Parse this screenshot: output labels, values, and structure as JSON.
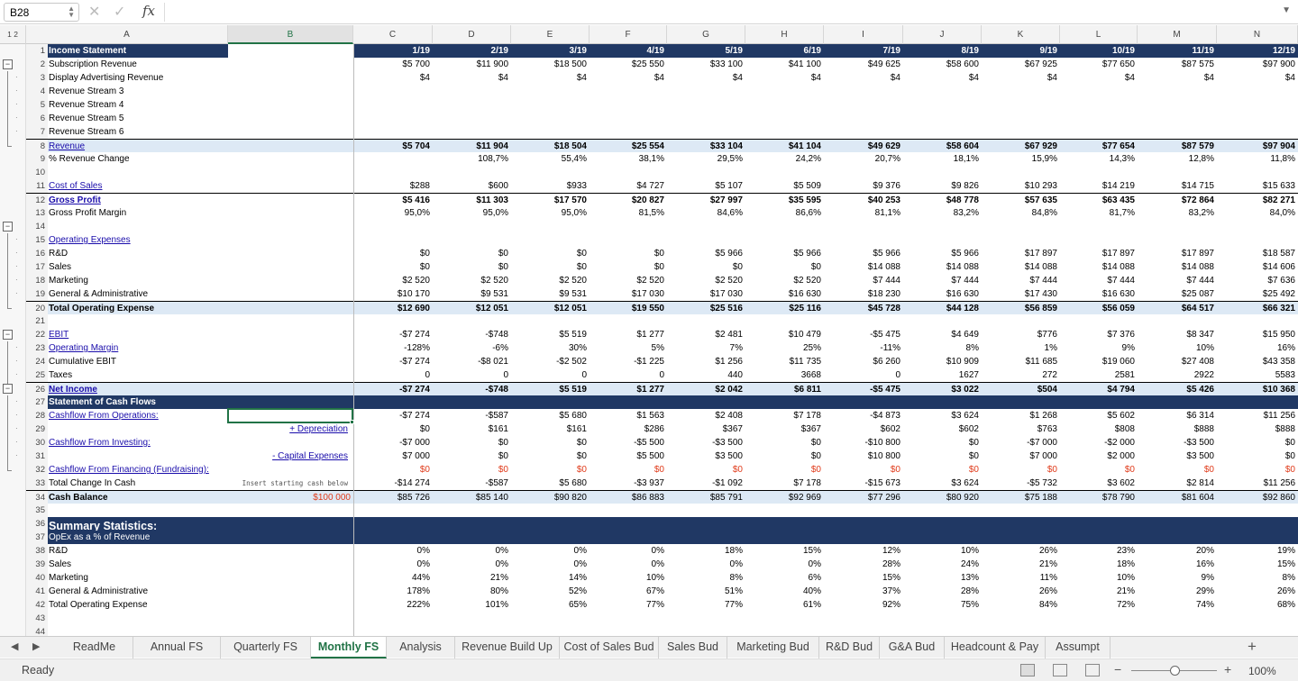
{
  "formula_bar": {
    "cell_ref": "B28",
    "formula": ""
  },
  "columns": [
    "A",
    "B",
    "C",
    "D",
    "E",
    "F",
    "G",
    "H",
    "I",
    "J",
    "K",
    "L",
    "M",
    "N"
  ],
  "outline_levels": [
    "1",
    "2"
  ],
  "rows": [
    {
      "n": "1",
      "label": "Income Statement",
      "style": "dark-label",
      "vals": [
        "1/19",
        "2/19",
        "3/19",
        "4/19",
        "5/19",
        "6/19",
        "7/19",
        "8/19",
        "9/19",
        "10/19",
        "11/19",
        "12/19"
      ]
    },
    {
      "n": "2",
      "label": "Subscription Revenue",
      "vals": [
        "$5 700",
        "$11 900",
        "$18 500",
        "$25 550",
        "$33 100",
        "$41 100",
        "$49 625",
        "$58 600",
        "$67 925",
        "$77 650",
        "$87 575",
        "$97 900"
      ]
    },
    {
      "n": "3",
      "label": "Display Advertising Revenue",
      "vals": [
        "$4",
        "$4",
        "$4",
        "$4",
        "$4",
        "$4",
        "$4",
        "$4",
        "$4",
        "$4",
        "$4",
        "$4"
      ]
    },
    {
      "n": "4",
      "label": "Revenue Stream 3",
      "vals": []
    },
    {
      "n": "5",
      "label": "Revenue Stream 4",
      "vals": []
    },
    {
      "n": "6",
      "label": "Revenue Stream 5",
      "vals": []
    },
    {
      "n": "7",
      "label": "Revenue Stream 6",
      "vals": []
    },
    {
      "n": "8",
      "label": "Revenue",
      "style": "hl link",
      "bold_vals": true,
      "vals": [
        "$5 704",
        "$11 904",
        "$18 504",
        "$25 554",
        "$33 104",
        "$41 104",
        "$49 629",
        "$58 604",
        "$67 929",
        "$77 654",
        "$87 579",
        "$97 904"
      ]
    },
    {
      "n": "9",
      "label": "% Revenue Change",
      "vals": [
        "",
        "108,7%",
        "55,4%",
        "38,1%",
        "29,5%",
        "24,2%",
        "20,7%",
        "18,1%",
        "15,9%",
        "14,3%",
        "12,8%",
        "11,8%"
      ]
    },
    {
      "n": "10",
      "label": "",
      "vals": []
    },
    {
      "n": "11",
      "label": "Cost of Sales",
      "style": "link",
      "vals": [
        "$288",
        "$600",
        "$933",
        "$4 727",
        "$5 107",
        "$5 509",
        "$9 376",
        "$9 826",
        "$10 293",
        "$14 219",
        "$14 715",
        "$15 633"
      ]
    },
    {
      "n": "12",
      "label": "Gross Profit",
      "style": "link bold",
      "bold_vals": true,
      "vals": [
        "$5 416",
        "$11 303",
        "$17 570",
        "$20 827",
        "$27 997",
        "$35 595",
        "$40 253",
        "$48 778",
        "$57 635",
        "$63 435",
        "$72 864",
        "$82 271"
      ]
    },
    {
      "n": "13",
      "label": "Gross Profit Margin",
      "vals": [
        "95,0%",
        "95,0%",
        "95,0%",
        "81,5%",
        "84,6%",
        "86,6%",
        "81,1%",
        "83,2%",
        "84,8%",
        "81,7%",
        "83,2%",
        "84,0%"
      ]
    },
    {
      "n": "14",
      "label": "",
      "vals": []
    },
    {
      "n": "15",
      "label": "Operating Expenses",
      "style": "link",
      "vals": []
    },
    {
      "n": "16",
      "label": "R&D",
      "vals": [
        "$0",
        "$0",
        "$0",
        "$0",
        "$5 966",
        "$5 966",
        "$5 966",
        "$5 966",
        "$17 897",
        "$17 897",
        "$17 897",
        "$18 587"
      ]
    },
    {
      "n": "17",
      "label": "Sales",
      "vals": [
        "$0",
        "$0",
        "$0",
        "$0",
        "$0",
        "$0",
        "$14 088",
        "$14 088",
        "$14 088",
        "$14 088",
        "$14 088",
        "$14 606"
      ]
    },
    {
      "n": "18",
      "label": "Marketing",
      "vals": [
        "$2 520",
        "$2 520",
        "$2 520",
        "$2 520",
        "$2 520",
        "$2 520",
        "$7 444",
        "$7 444",
        "$7 444",
        "$7 444",
        "$7 444",
        "$7 636"
      ]
    },
    {
      "n": "19",
      "label": "General & Administrative",
      "vals": [
        "$10 170",
        "$9 531",
        "$9 531",
        "$17 030",
        "$17 030",
        "$16 630",
        "$18 230",
        "$16 630",
        "$17 430",
        "$16 630",
        "$25 087",
        "$25 492"
      ]
    },
    {
      "n": "20",
      "label": "Total Operating Expense",
      "style": "hl bold",
      "bold_vals": true,
      "vals": [
        "$12 690",
        "$12 051",
        "$12 051",
        "$19 550",
        "$25 516",
        "$25 116",
        "$45 728",
        "$44 128",
        "$56 859",
        "$56 059",
        "$64 517",
        "$66 321"
      ]
    },
    {
      "n": "21",
      "label": "",
      "vals": []
    },
    {
      "n": "22",
      "label": "EBIT",
      "style": "link",
      "vals": [
        "-$7 274",
        "-$748",
        "$5 519",
        "$1 277",
        "$2 481",
        "$10 479",
        "-$5 475",
        "$4 649",
        "$776",
        "$7 376",
        "$8 347",
        "$15 950"
      ]
    },
    {
      "n": "23",
      "label": "Operating Margin",
      "style": "link",
      "vals": [
        "-128%",
        "-6%",
        "30%",
        "5%",
        "7%",
        "25%",
        "-11%",
        "8%",
        "1%",
        "9%",
        "10%",
        "16%"
      ]
    },
    {
      "n": "24",
      "label": "Cumulative EBIT",
      "vals": [
        "-$7 274",
        "-$8 021",
        "-$2 502",
        "-$1 225",
        "$1 256",
        "$11 735",
        "$6 260",
        "$10 909",
        "$11 685",
        "$19 060",
        "$27 408",
        "$43 358"
      ]
    },
    {
      "n": "25",
      "label": "Taxes",
      "vals": [
        "0",
        "0",
        "0",
        "0",
        "440",
        "3668",
        "0",
        "1627",
        "272",
        "2581",
        "2922",
        "5583"
      ]
    },
    {
      "n": "26",
      "label": "Net Income",
      "style": "hl link bold",
      "bold_vals": true,
      "vals": [
        "-$7 274",
        "-$748",
        "$5 519",
        "$1 277",
        "$2 042",
        "$6 811",
        "-$5 475",
        "$3 022",
        "$504",
        "$4 794",
        "$5 426",
        "$10 368"
      ]
    },
    {
      "n": "27",
      "label": "Statement of Cash Flows",
      "style": "dark-row",
      "vals": []
    },
    {
      "n": "28",
      "label": "Cashflow From Operations:",
      "style": "link",
      "vals": [
        "-$7 274",
        "-$587",
        "$5 680",
        "$1 563",
        "$2 408",
        "$7 178",
        "-$4 873",
        "$3 624",
        "$1 268",
        "$5 602",
        "$6 314",
        "$11 256"
      ]
    },
    {
      "n": "29",
      "label": "",
      "b": "+ Depreciation",
      "vals": [
        "$0",
        "$161",
        "$161",
        "$286",
        "$367",
        "$367",
        "$602",
        "$602",
        "$763",
        "$808",
        "$888",
        "$888"
      ]
    },
    {
      "n": "30",
      "label": "Cashflow From Investing:",
      "style": "link",
      "vals": [
        "-$7 000",
        "$0",
        "$0",
        "-$5 500",
        "-$3 500",
        "$0",
        "-$10 800",
        "$0",
        "-$7 000",
        "-$2 000",
        "-$3 500",
        "$0"
      ]
    },
    {
      "n": "31",
      "label": "",
      "b": "- Capital Expenses",
      "vals": [
        "$7 000",
        "$0",
        "$0",
        "$5 500",
        "$3 500",
        "$0",
        "$10 800",
        "$0",
        "$7 000",
        "$2 000",
        "$3 500",
        "$0"
      ]
    },
    {
      "n": "32",
      "label": "Cashflow From Financing (Fundraising):",
      "style": "link",
      "red_vals": true,
      "vals": [
        "$0",
        "$0",
        "$0",
        "$0",
        "$0",
        "$0",
        "$0",
        "$0",
        "$0",
        "$0",
        "$0",
        "$0"
      ]
    },
    {
      "n": "33",
      "label": "Total Change In Cash",
      "b_hint": "Insert starting cash below",
      "vals": [
        "-$14 274",
        "-$587",
        "$5 680",
        "-$3 937",
        "-$1 092",
        "$7 178",
        "-$15 673",
        "$3 624",
        "-$5 732",
        "$3 602",
        "$2 814",
        "$11 256"
      ]
    },
    {
      "n": "34",
      "label": "Cash Balance",
      "style": "hl bold",
      "b_red": "$100 000",
      "vals": [
        "$85 726",
        "$85 140",
        "$90 820",
        "$86 883",
        "$85 791",
        "$92 969",
        "$77 296",
        "$80 920",
        "$75 188",
        "$78 790",
        "$81 604",
        "$92 860"
      ]
    },
    {
      "n": "35",
      "label": "",
      "vals": []
    },
    {
      "n": "36",
      "label": "Summary Statistics:",
      "style": "dark-big",
      "vals": []
    },
    {
      "n": "37",
      "label": "OpEx as a % of Revenue",
      "style": "dark-row-normal",
      "vals": []
    },
    {
      "n": "38",
      "label": "R&D",
      "vals": [
        "0%",
        "0%",
        "0%",
        "0%",
        "18%",
        "15%",
        "12%",
        "10%",
        "26%",
        "23%",
        "20%",
        "19%"
      ]
    },
    {
      "n": "39",
      "label": "Sales",
      "vals": [
        "0%",
        "0%",
        "0%",
        "0%",
        "0%",
        "0%",
        "28%",
        "24%",
        "21%",
        "18%",
        "16%",
        "15%"
      ]
    },
    {
      "n": "40",
      "label": "Marketing",
      "vals": [
        "44%",
        "21%",
        "14%",
        "10%",
        "8%",
        "6%",
        "15%",
        "13%",
        "11%",
        "10%",
        "9%",
        "8%"
      ]
    },
    {
      "n": "41",
      "label": "General & Administrative",
      "vals": [
        "178%",
        "80%",
        "52%",
        "67%",
        "51%",
        "40%",
        "37%",
        "28%",
        "26%",
        "21%",
        "29%",
        "26%"
      ]
    },
    {
      "n": "42",
      "label": "Total Operating Expense",
      "vals": [
        "222%",
        "101%",
        "65%",
        "77%",
        "77%",
        "61%",
        "92%",
        "75%",
        "84%",
        "72%",
        "74%",
        "68%"
      ]
    },
    {
      "n": "43",
      "label": "",
      "vals": []
    },
    {
      "n": "44",
      "label": "",
      "vals": []
    }
  ],
  "sheet_tabs": [
    "ReadMe",
    "Annual FS",
    "Quarterly FS",
    "Monthly FS",
    "Analysis",
    "Revenue Build Up",
    "Cost of Sales Bud",
    "Sales Bud",
    "Marketing Bud",
    "R&D Bud",
    "G&A Bud",
    "Headcount & Pay",
    "Assumpt"
  ],
  "active_tab": "Monthly FS",
  "status": {
    "ready": "Ready",
    "zoom": "100%"
  }
}
